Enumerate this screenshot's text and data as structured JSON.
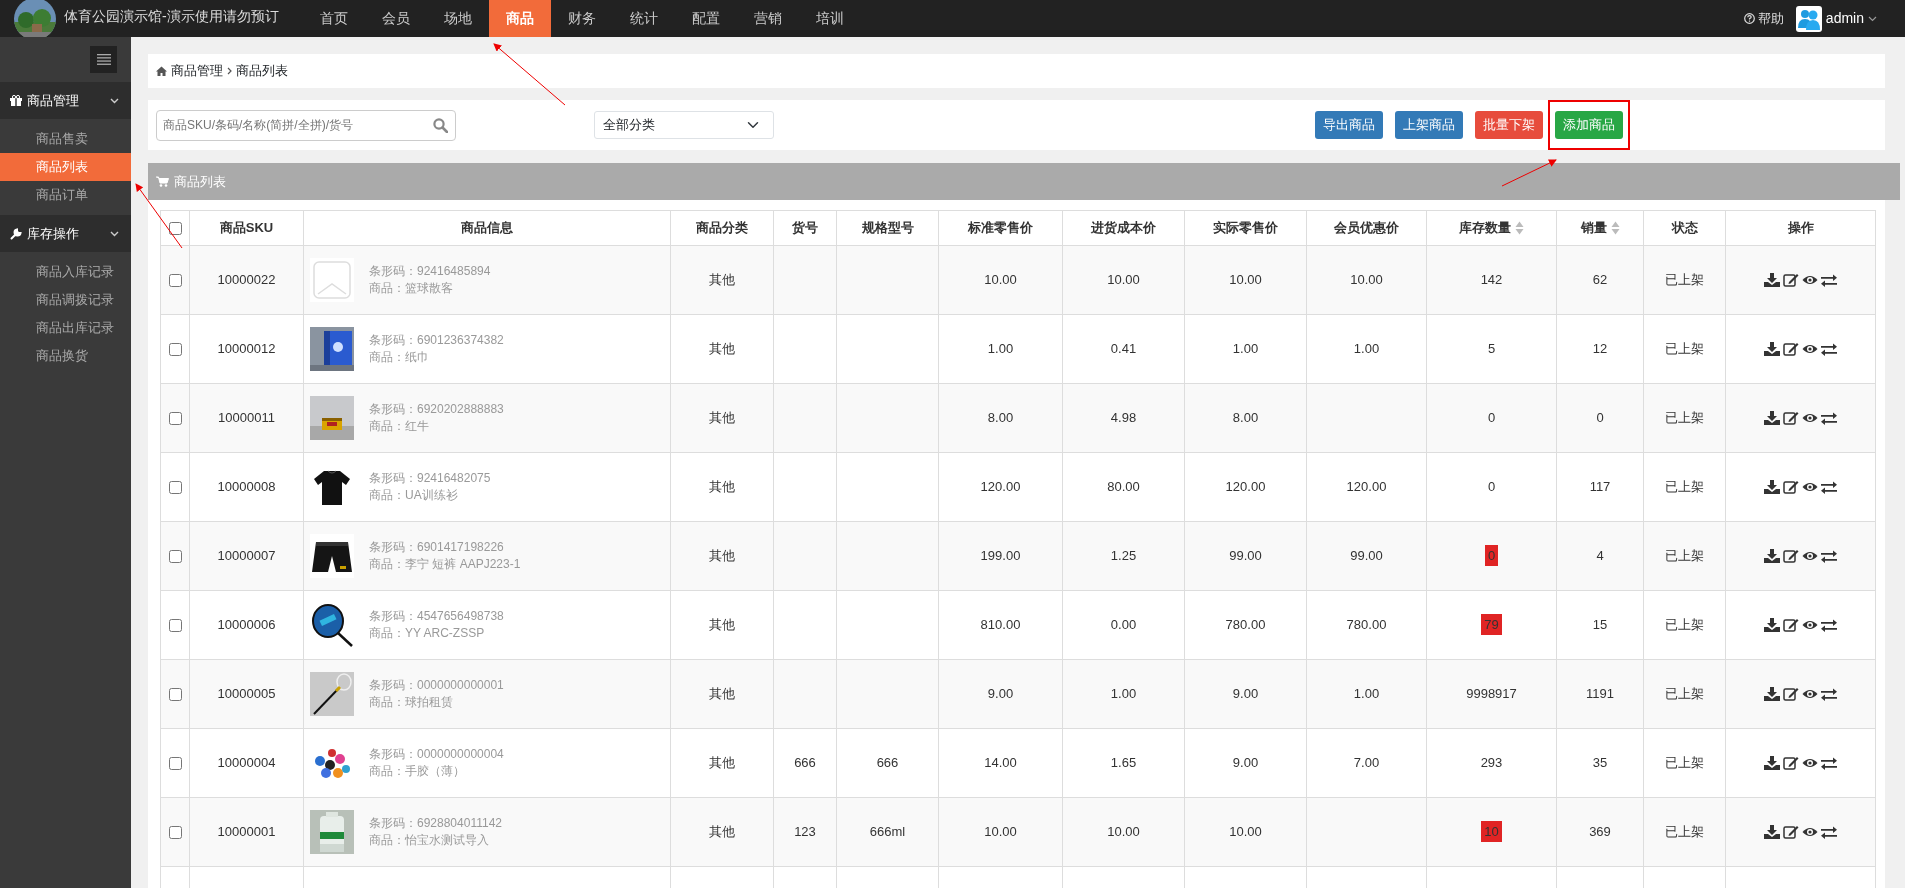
{
  "header": {
    "title": "体育公园演示馆-演示使用请勿预订",
    "nav": [
      {
        "label": "首页",
        "selected": false
      },
      {
        "label": "会员",
        "selected": false
      },
      {
        "label": "场地",
        "selected": false
      },
      {
        "label": "商品",
        "selected": true
      },
      {
        "label": "财务",
        "selected": false
      },
      {
        "label": "统计",
        "selected": false
      },
      {
        "label": "配置",
        "selected": false
      },
      {
        "label": "营销",
        "selected": false
      },
      {
        "label": "培训",
        "selected": false
      }
    ],
    "help": "帮助",
    "user": "admin"
  },
  "sidebar": {
    "groups": [
      {
        "label": "商品管理",
        "expanded": true,
        "items": [
          {
            "label": "商品售卖",
            "selected": false
          },
          {
            "label": "商品列表",
            "selected": true
          },
          {
            "label": "商品订单",
            "selected": false
          }
        ]
      },
      {
        "label": "库存操作",
        "expanded": true,
        "items": [
          {
            "label": "商品入库记录",
            "selected": false
          },
          {
            "label": "商品调拨记录",
            "selected": false
          },
          {
            "label": "商品出库记录",
            "selected": false
          },
          {
            "label": "商品换货",
            "selected": false
          }
        ]
      }
    ]
  },
  "breadcrumb": [
    "商品管理",
    "商品列表"
  ],
  "search": {
    "placeholder": "商品SKU/条码/名称(简拼/全拼)/货号"
  },
  "category_select": {
    "value": "全部分类"
  },
  "buttons": [
    {
      "label": "导出商品",
      "kind": "primary",
      "highlighted": false
    },
    {
      "label": "上架商品",
      "kind": "primary",
      "highlighted": false
    },
    {
      "label": "批量下架",
      "kind": "danger",
      "highlighted": false
    },
    {
      "label": "添加商品",
      "kind": "success",
      "highlighted": true
    }
  ],
  "panel": {
    "title": "商品列表"
  },
  "table": {
    "select_all": {
      "checked": false
    },
    "columns": [
      {
        "label": "商品SKU",
        "sortable": false
      },
      {
        "label": "商品信息",
        "sortable": false
      },
      {
        "label": "商品分类",
        "sortable": false
      },
      {
        "label": "货号",
        "sortable": false
      },
      {
        "label": "规格型号",
        "sortable": false
      },
      {
        "label": "标准零售价",
        "sortable": false
      },
      {
        "label": "进货成本价",
        "sortable": false
      },
      {
        "label": "实际零售价",
        "sortable": false
      },
      {
        "label": "会员优惠价",
        "sortable": false
      },
      {
        "label": "库存数量",
        "sortable": true
      },
      {
        "label": "销量",
        "sortable": true
      },
      {
        "label": "状态",
        "sortable": false
      },
      {
        "label": "操作",
        "sortable": false
      }
    ],
    "rows": [
      {
        "checked": false,
        "sku": "10000022",
        "barcode": "条形码：92416485894",
        "name": "商品：篮球散客",
        "category": "其他",
        "retail": "10.00",
        "cost": "10.00",
        "actual": "10.00",
        "member": "10.00",
        "stock": "142",
        "stock_alert": false,
        "sales": "62",
        "status": "已上架"
      },
      {
        "checked": false,
        "sku": "10000012",
        "barcode": "条形码：6901236374382",
        "name": "商品：纸巾",
        "category": "其他",
        "retail": "1.00",
        "cost": "0.41",
        "actual": "1.00",
        "member": "1.00",
        "stock": "5",
        "stock_alert": false,
        "sales": "12",
        "status": "已上架"
      },
      {
        "checked": false,
        "sku": "10000011",
        "barcode": "条形码：6920202888883",
        "name": "商品：红牛",
        "category": "其他",
        "retail": "8.00",
        "cost": "4.98",
        "actual": "8.00",
        "stock": "0",
        "stock_alert": false,
        "sales": "0",
        "status": "已上架"
      },
      {
        "checked": false,
        "sku": "10000008",
        "barcode": "条形码：92416482075",
        "name": "商品：UA训练衫",
        "category": "其他",
        "retail": "120.00",
        "cost": "80.00",
        "actual": "120.00",
        "member": "120.00",
        "stock": "0",
        "stock_alert": false,
        "sales": "117",
        "status": "已上架"
      },
      {
        "checked": false,
        "sku": "10000007",
        "barcode": "条形码：6901417198226",
        "name": "商品：李宁 短裤 AAPJ223-1",
        "category": "其他",
        "retail": "199.00",
        "cost": "1.25",
        "actual": "99.00",
        "member": "99.00",
        "stock": "0",
        "stock_alert": true,
        "sales": "4",
        "status": "已上架"
      },
      {
        "checked": false,
        "sku": "10000006",
        "barcode": "条形码：4547656498738",
        "name": "商品：YY ARC-ZSSP",
        "category": "其他",
        "retail": "810.00",
        "cost": "0.00",
        "actual": "780.00",
        "member": "780.00",
        "stock": "79",
        "stock_alert": true,
        "sales": "15",
        "status": "已上架"
      },
      {
        "checked": false,
        "sku": "10000005",
        "barcode": "条形码：0000000000001",
        "name": "商品：球拍租赁",
        "category": "其他",
        "retail": "9.00",
        "cost": "1.00",
        "actual": "9.00",
        "member": "1.00",
        "stock": "9998917",
        "stock_alert": false,
        "sales": "1191",
        "status": "已上架"
      },
      {
        "checked": false,
        "sku": "10000004",
        "barcode": "条形码：0000000000004",
        "name": "商品：手胶（薄）",
        "category": "其他",
        "item_no": "666",
        "spec": "666",
        "retail": "14.00",
        "cost": "1.65",
        "actual": "9.00",
        "member": "7.00",
        "stock": "293",
        "stock_alert": false,
        "sales": "35",
        "status": "已上架"
      },
      {
        "checked": false,
        "sku": "10000001",
        "barcode": "条形码：6928804011142",
        "name": "商品：怡宝水测试导入",
        "category": "其他",
        "item_no": "123",
        "spec": "666ml",
        "retail": "10.00",
        "cost": "10.00",
        "actual": "10.00",
        "stock": "10",
        "stock_alert": true,
        "sales": "369",
        "status": "已上架"
      }
    ]
  }
}
